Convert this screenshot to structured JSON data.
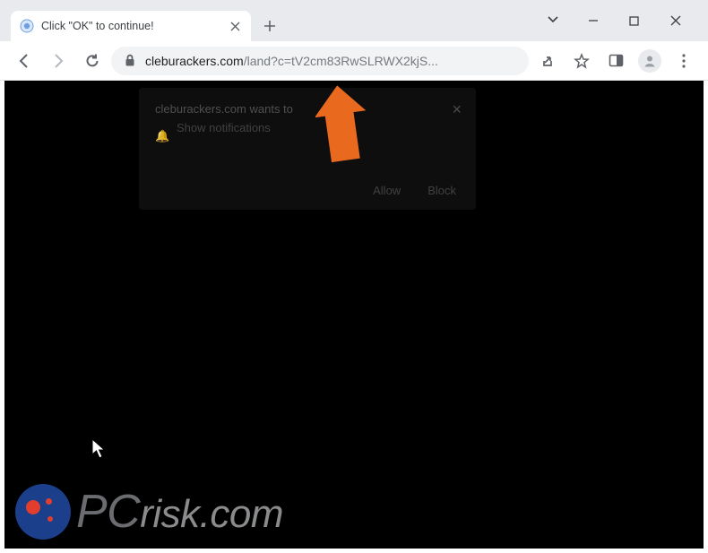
{
  "window": {
    "tab_title": "Click \"OK\" to continue!",
    "controls": {
      "chevron": "⌄",
      "minimize": "—",
      "maximize": "☐",
      "close": "✕"
    }
  },
  "toolbar": {
    "url_host": "cleburackers.com",
    "url_path": "/land?c=tV2cm83RwSLRWX2kjS..."
  },
  "dialog": {
    "line1": "cleburackers.com wants to",
    "line2": "Show notifications",
    "allow": "Allow",
    "block": "Block"
  },
  "watermark": {
    "left": "PC",
    "right": "risk.com"
  }
}
